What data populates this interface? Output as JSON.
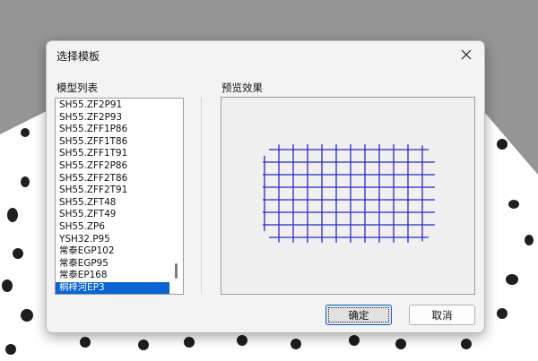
{
  "dialog": {
    "title": "选择模板",
    "close_icon": "close-icon"
  },
  "template_list": {
    "label": "模型列表",
    "items": [
      "SH55.ZF2P91",
      "SH55.ZF2P93",
      "SH55.ZFF1P86",
      "SH55.ZFF1T86",
      "SH55.ZFF1T91",
      "SH55.ZFF2P86",
      "SH55.ZFF2T86",
      "SH55.ZFF2T91",
      "SH55.ZFT48",
      "SH55.ZFT49",
      "SH55.ZP6",
      "YSH32.P95",
      "常泰EGP102",
      "常泰EGP95",
      "常泰EP168",
      "桐梓河EP3"
    ],
    "selected_index": 15
  },
  "preview": {
    "label": "预览效果",
    "grid_color": "#2828c8"
  },
  "buttons": {
    "ok_label": "确定",
    "cancel_label": "取消"
  },
  "colors": {
    "selection": "#0a64d2",
    "dialog_bg": "#f3f3f3"
  }
}
